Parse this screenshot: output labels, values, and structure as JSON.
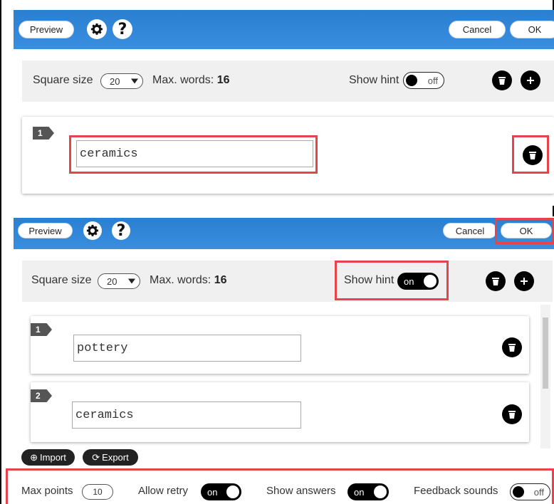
{
  "toolbar": {
    "preview_label": "Preview",
    "cancel_label": "Cancel",
    "ok_label": "OK",
    "help_glyph": "?",
    "settings_icon": "gear-icon"
  },
  "top_panel": {
    "square_size_label": "Square size",
    "square_size_value": "20",
    "max_words_label": "Max. words:",
    "max_words_value": "16",
    "show_hint_label": "Show hint",
    "show_hint_state": "off",
    "words": [
      {
        "number": "1",
        "value": "ceramics"
      }
    ]
  },
  "bottom_panel": {
    "square_size_label": "Square size",
    "square_size_value": "20",
    "max_words_label": "Max. words:",
    "max_words_value": "16",
    "show_hint_label": "Show hint",
    "show_hint_state": "on",
    "words": [
      {
        "number": "1",
        "value": "pottery"
      },
      {
        "number": "2",
        "value": "ceramics"
      }
    ],
    "import_label": "Import",
    "export_label": "Export"
  },
  "settings": {
    "max_points_label": "Max points",
    "max_points_value": "10",
    "allow_retry_label": "Allow retry",
    "allow_retry_state": "on",
    "show_answers_label": "Show answers",
    "show_answers_state": "on",
    "feedback_sounds_label": "Feedback sounds",
    "feedback_sounds_state": "off"
  },
  "colors": {
    "topbar": "#3a8ee0",
    "highlight": "#e8434a",
    "panel_bg": "#f0f0f0"
  }
}
